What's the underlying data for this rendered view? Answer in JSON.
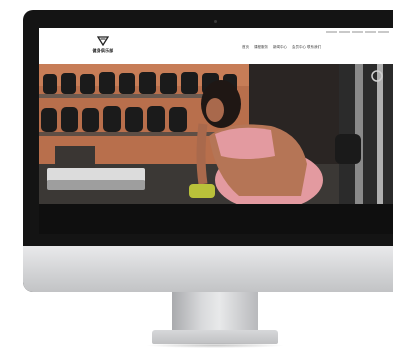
{
  "website": {
    "logo_text": "健身俱乐部",
    "nav": [
      "首页",
      "课程服务",
      "新闻中心",
      "会员中心 联系我们"
    ],
    "topbar_link_count": 5
  },
  "hero": {
    "scene": "gym-training-photo"
  },
  "colors": {
    "bezel": "#141414",
    "chin": "#d3d4d6",
    "accent_pink": "#e39aa0",
    "wall_orange": "#c97a52"
  }
}
